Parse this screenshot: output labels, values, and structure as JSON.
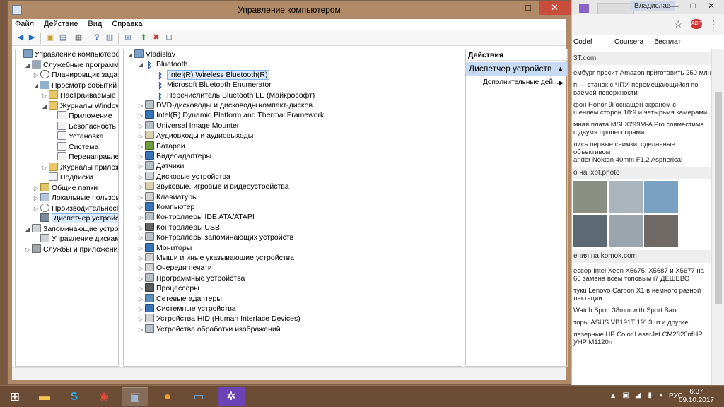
{
  "window": {
    "title": "Управление компьютером",
    "menu": [
      "Файл",
      "Действие",
      "Вид",
      "Справка"
    ],
    "buttons": {
      "minimize": "—",
      "maximize": "□",
      "close": "✕"
    }
  },
  "left_tree": [
    {
      "label": "Управление компьютером (л",
      "level": 0,
      "toggle": "",
      "icon": "computer-management-icon",
      "cls": "i-comp"
    },
    {
      "label": "Служебные программы",
      "level": 1,
      "toggle": "◢",
      "icon": "tools-icon",
      "cls": "i-tools"
    },
    {
      "label": "Планировщик заданий",
      "level": 2,
      "toggle": "▷",
      "icon": "clock-icon",
      "cls": "i-clock"
    },
    {
      "label": "Просмотр событий",
      "level": 2,
      "toggle": "◢",
      "icon": "event-viewer-icon",
      "cls": "i-event"
    },
    {
      "label": "Настраиваемые пр",
      "level": 3,
      "toggle": "▷",
      "icon": "folder-icon",
      "cls": "i-folder"
    },
    {
      "label": "Журналы Windows",
      "level": 3,
      "toggle": "◢",
      "icon": "folder-icon",
      "cls": "i-folder"
    },
    {
      "label": "Приложение",
      "level": 4,
      "toggle": "",
      "icon": "log-icon",
      "cls": "i-log"
    },
    {
      "label": "Безопасность",
      "level": 4,
      "toggle": "",
      "icon": "log-icon",
      "cls": "i-log"
    },
    {
      "label": "Установка",
      "level": 4,
      "toggle": "",
      "icon": "log-icon",
      "cls": "i-log"
    },
    {
      "label": "Система",
      "level": 4,
      "toggle": "",
      "icon": "log-icon",
      "cls": "i-log"
    },
    {
      "label": "Перенаправлен",
      "level": 4,
      "toggle": "",
      "icon": "log-icon",
      "cls": "i-log"
    },
    {
      "label": "Журналы приложе",
      "level": 3,
      "toggle": "▷",
      "icon": "folder-icon",
      "cls": "i-folder"
    },
    {
      "label": "Подписки",
      "level": 3,
      "toggle": "",
      "icon": "log-icon",
      "cls": "i-log"
    },
    {
      "label": "Общие папки",
      "level": 2,
      "toggle": "▷",
      "icon": "shared-folder-icon",
      "cls": "i-share"
    },
    {
      "label": "Локальные пользовате",
      "level": 2,
      "toggle": "▷",
      "icon": "users-icon",
      "cls": "i-users"
    },
    {
      "label": "Производительность",
      "level": 2,
      "toggle": "▷",
      "icon": "performance-icon",
      "cls": "i-perf"
    },
    {
      "label": "Диспетчер устройств",
      "level": 2,
      "toggle": "",
      "icon": "device-manager-icon",
      "cls": "i-dev",
      "selected": true
    },
    {
      "label": "Запоминающие устройст",
      "level": 1,
      "toggle": "◢",
      "icon": "storage-icon",
      "cls": "i-disk"
    },
    {
      "label": "Управление дисками",
      "level": 2,
      "toggle": "",
      "icon": "disk-icon",
      "cls": "i-disk"
    },
    {
      "label": "Службы и приложения",
      "level": 1,
      "toggle": "▷",
      "icon": "services-icon",
      "cls": "i-svc"
    }
  ],
  "device_tree": [
    {
      "label": "Vladislav",
      "level": 0,
      "toggle": "◢",
      "icon": "computer-icon",
      "cls": "i-comp"
    },
    {
      "label": "Bluetooth",
      "level": 1,
      "toggle": "◢",
      "icon": "bluetooth-icon",
      "cls": "i-bt"
    },
    {
      "label": "Intel(R) Wireless Bluetooth(R)",
      "level": 2,
      "toggle": "",
      "icon": "bluetooth-icon",
      "cls": "i-bt",
      "selected": true
    },
    {
      "label": "Microsoft Bluetooth Enumerator",
      "level": 2,
      "toggle": "",
      "icon": "bluetooth-icon",
      "cls": "i-bt"
    },
    {
      "label": "Перечислитель Bluetooth LE (Майкрософт)",
      "level": 2,
      "toggle": "",
      "icon": "bluetooth-icon",
      "cls": "i-bt"
    },
    {
      "label": "DVD-дисководы и дисководы компакт-дисков",
      "level": 1,
      "toggle": "▷",
      "icon": "dvd-icon",
      "cls": "i-gen"
    },
    {
      "label": "Intel(R) Dynamic Platform and Thermal Framework",
      "level": 1,
      "toggle": "▷",
      "icon": "device-icon",
      "cls": "i-monitor"
    },
    {
      "label": "Universal Image Mounter",
      "level": 1,
      "toggle": "▷",
      "icon": "device-icon",
      "cls": "i-gen"
    },
    {
      "label": "Аудиовходы и аудиовыходы",
      "level": 1,
      "toggle": "▷",
      "icon": "audio-icon",
      "cls": "i-audio"
    },
    {
      "label": "Батареи",
      "level": 1,
      "toggle": "▷",
      "icon": "battery-icon",
      "cls": "i-battery"
    },
    {
      "label": "Видеоадаптеры",
      "level": 1,
      "toggle": "▷",
      "icon": "display-adapter-icon",
      "cls": "i-monitor"
    },
    {
      "label": "Датчики",
      "level": 1,
      "toggle": "▷",
      "icon": "sensor-icon",
      "cls": "i-gen"
    },
    {
      "label": "Дисковые устройства",
      "level": 1,
      "toggle": "▷",
      "icon": "disk-icon",
      "cls": "i-disk"
    },
    {
      "label": "Звуковые, игровые и видеоустройства",
      "level": 1,
      "toggle": "▷",
      "icon": "sound-icon",
      "cls": "i-audio"
    },
    {
      "label": "Клавиатуры",
      "level": 1,
      "toggle": "▷",
      "icon": "keyboard-icon",
      "cls": "i-kbd"
    },
    {
      "label": "Компьютер",
      "level": 1,
      "toggle": "▷",
      "icon": "computer-icon",
      "cls": "i-monitor"
    },
    {
      "label": "Контроллеры IDE ATA/ATAPI",
      "level": 1,
      "toggle": "▷",
      "icon": "controller-icon",
      "cls": "i-gen"
    },
    {
      "label": "Контроллеры USB",
      "level": 1,
      "toggle": "▷",
      "icon": "usb-icon",
      "cls": "i-usb"
    },
    {
      "label": "Контроллеры запоминающих устройств",
      "level": 1,
      "toggle": "▷",
      "icon": "storage-controller-icon",
      "cls": "i-gen"
    },
    {
      "label": "Мониторы",
      "level": 1,
      "toggle": "▷",
      "icon": "monitor-icon",
      "cls": "i-monitor"
    },
    {
      "label": "Мыши и иные указывающие устройства",
      "level": 1,
      "toggle": "▷",
      "icon": "mouse-icon",
      "cls": "i-kbd"
    },
    {
      "label": "Очереди печати",
      "level": 1,
      "toggle": "▷",
      "icon": "printer-icon",
      "cls": "i-kbd"
    },
    {
      "label": "Программные устройства",
      "level": 1,
      "toggle": "▷",
      "icon": "software-device-icon",
      "cls": "i-gen"
    },
    {
      "label": "Процессоры",
      "level": 1,
      "toggle": "▷",
      "icon": "cpu-icon",
      "cls": "i-cpu"
    },
    {
      "label": "Сетевые адаптеры",
      "level": 1,
      "toggle": "▷",
      "icon": "network-adapter-icon",
      "cls": "i-net"
    },
    {
      "label": "Системные устройства",
      "level": 1,
      "toggle": "▷",
      "icon": "system-device-icon",
      "cls": "i-monitor"
    },
    {
      "label": "Устройства HID (Human Interface Devices)",
      "level": 1,
      "toggle": "▷",
      "icon": "hid-icon",
      "cls": "i-kbd"
    },
    {
      "label": "Устройства обработки изображений",
      "level": 1,
      "toggle": "▷",
      "icon": "imaging-device-icon",
      "cls": "i-gen"
    }
  ],
  "actions": {
    "header": "Действия",
    "section": "Диспетчер устройств",
    "item": "Дополнительные дей..."
  },
  "browser": {
    "user": "Владислав",
    "bookmarks": [
      "Codef",
      "Coursera — бесплат"
    ],
    "sections": [
      {
        "type": "head",
        "text": "3T.com"
      },
      {
        "type": "news",
        "text": "ембург просит Amazon приготовить 250 млн"
      },
      {
        "type": "news",
        "text": "п — станок с ЧПУ, перемещающийся по\nваемой поверхности"
      },
      {
        "type": "news",
        "text": "фон Honor 9i оснащен экраном с\nшением сторон 18:9 и четырьмя камерами"
      },
      {
        "type": "news",
        "text": "мная плата MSI X299M-A Pro совместима\nс двумя процессорами"
      },
      {
        "type": "news",
        "text": "лись первые снимки, сделанные объективом\nander Nokton 40mm F1.2 Aspherical"
      },
      {
        "type": "head",
        "text": "о на ixbt.photo"
      },
      {
        "type": "thumbs"
      },
      {
        "type": "head",
        "text": "ения на komok.com"
      },
      {
        "type": "news",
        "text": "ессор Intel Xeon X5675, X5687 и X5677 на\n66 замена всем топовым i7 ДЕШЕВО"
      },
      {
        "type": "news",
        "text": "тукu Lenovo Carbon X1 в немного разной\nлектации"
      },
      {
        "type": "news",
        "text": "Watch Sport 38mm with Sport Band"
      },
      {
        "type": "news",
        "text": "торы ASUS VB191T 19\" 3шт.и другие"
      },
      {
        "type": "news",
        "text": "лазерные HP Color LaserJet CM2320nfHP\n)/HP M1120n"
      }
    ]
  },
  "taskbar": {
    "apps": [
      "file-explorer-icon",
      "skype-icon",
      "chrome-icon",
      "computer-management-icon",
      "browser-icon",
      "remote-desktop-icon",
      "settings-icon"
    ],
    "lang": "РУС",
    "time": "6:37",
    "date": "09.10.2017"
  }
}
